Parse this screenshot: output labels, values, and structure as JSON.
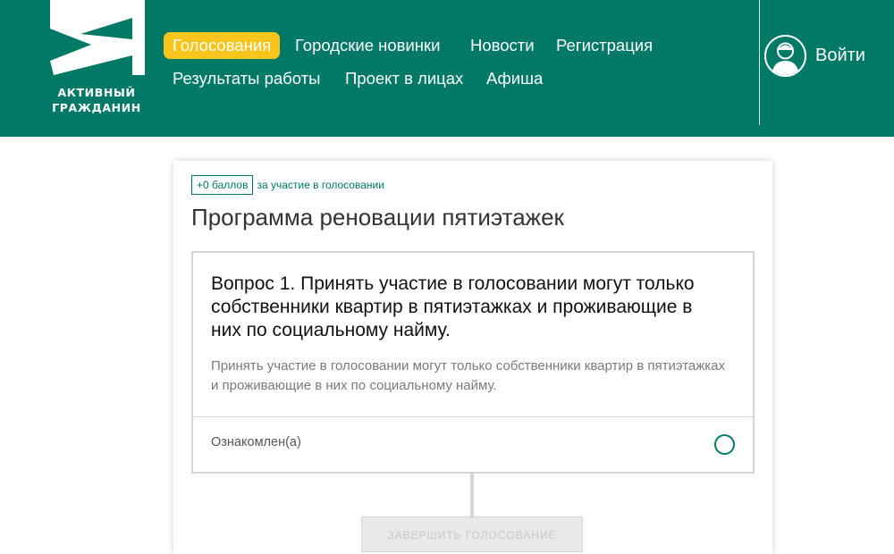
{
  "logo": {
    "icon": "letter-a-logo-icon",
    "line1": "АКТИВНЫЙ",
    "line2": "ГРАЖДАНИН"
  },
  "nav": {
    "row1": [
      "Голосования",
      "Городские новинки",
      "Новости",
      "Регистрация"
    ],
    "row2": [
      "Результаты работы",
      "Проект в лицах",
      "Афиша"
    ],
    "active": "Голосования"
  },
  "login": {
    "icon": "user-avatar-icon",
    "label": "Войти"
  },
  "colors": {
    "brand": "#007a67",
    "accent": "#f7c51b"
  },
  "card": {
    "badge": "+0 баллов",
    "badge_caption": "за участие в голосовании",
    "title": "Программа реновации пятиэтажек",
    "question": {
      "title": "Вопрос 1. Принять участие в голосовании могут только собственники квартир в пятиэтажках и проживающие в них по социальному найму.",
      "description": "Принять участие в голосовании могут только собственники квартир в пятиэтажках и проживающие в них по социальному найму.",
      "option": "Ознакомлен(а)",
      "option_selected": false
    },
    "finish_button": "ЗАВЕРШИТЬ ГОЛОСОВАНИЕ"
  }
}
